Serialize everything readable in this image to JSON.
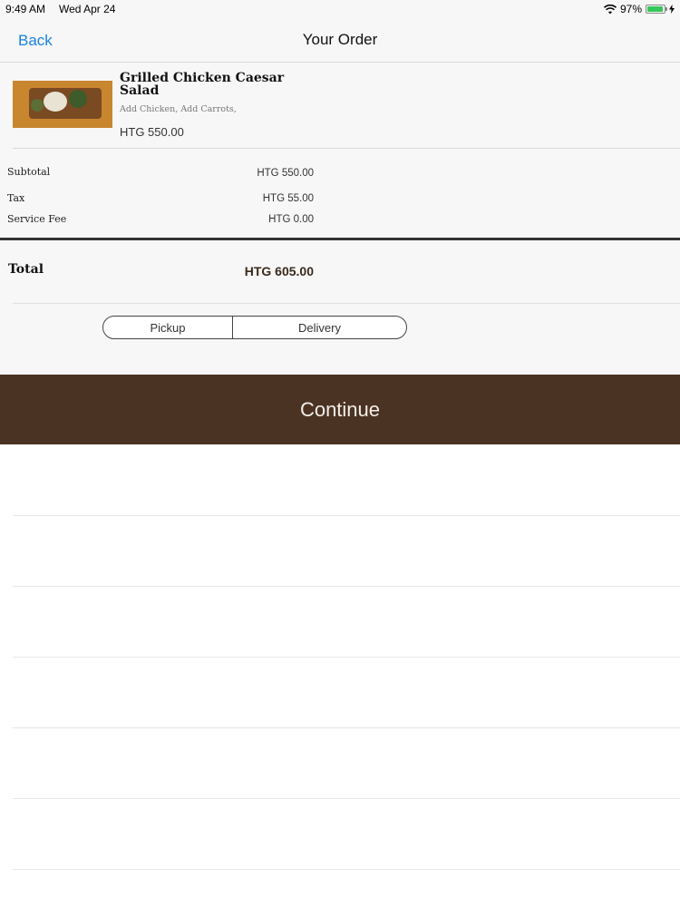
{
  "status_bar": {
    "time": "9:49 AM",
    "date": "Wed Apr 24",
    "battery": "97%",
    "battery_level": 0.97,
    "accent_color": "#34c759"
  },
  "nav": {
    "back_label": "Back",
    "title": "Your Order",
    "link_color": "#1a82e0"
  },
  "order": {
    "item": {
      "name": "Grilled Chicken Caesar Salad",
      "options": "Add Chicken, Add Carrots,",
      "price": "HTG 550.00"
    },
    "summary": [
      {
        "label": "Subtotal",
        "value": "HTG 550.00"
      },
      {
        "label": "Tax",
        "value": "HTG 55.00"
      },
      {
        "label": "Service Fee",
        "value": "HTG 0.00"
      }
    ],
    "total_label": "Total",
    "total_value": "HTG 605.00"
  },
  "fulfillment": {
    "options": [
      "Pickup",
      "Delivery"
    ]
  },
  "continue_label": "Continue",
  "brand_color": "#4b3324"
}
